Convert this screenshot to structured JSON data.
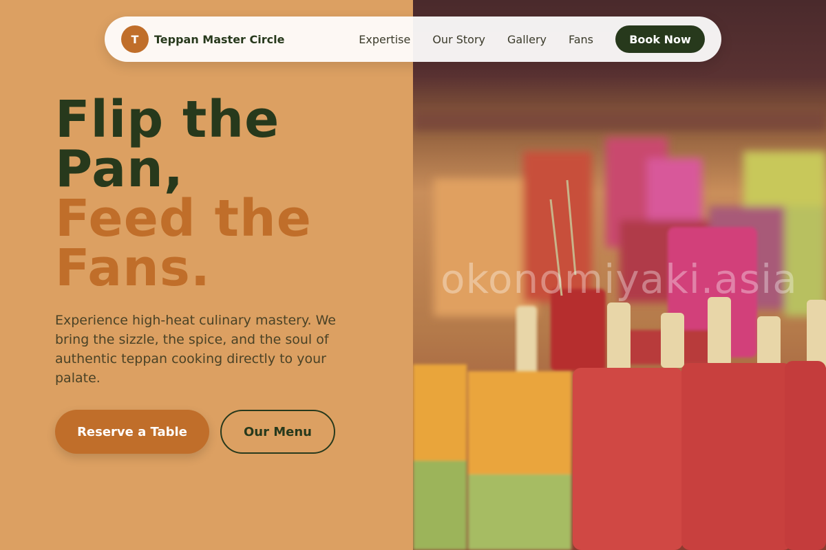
{
  "nav": {
    "logo_letter": "T",
    "brand": "Teppan Master Circle",
    "links": [
      "Expertise",
      "Our Story",
      "Gallery",
      "Fans"
    ],
    "cta": "Book Now"
  },
  "hero": {
    "title_line1": "Flip the",
    "title_line2": "Pan,",
    "title_line3": "Feed the",
    "title_line4": "Fans.",
    "description": "Experience high-heat culinary mastery. We bring the sizzle, the spice, and the soul of authentic teppan cooking directly to your palate.",
    "primary_button": "Reserve a Table",
    "secondary_button": "Our Menu"
  },
  "image": {
    "watermark": "okonomiyaki.asia"
  },
  "colors": {
    "background": "#dca062",
    "dark_green": "#27391c",
    "accent_orange": "#c06e2a"
  }
}
